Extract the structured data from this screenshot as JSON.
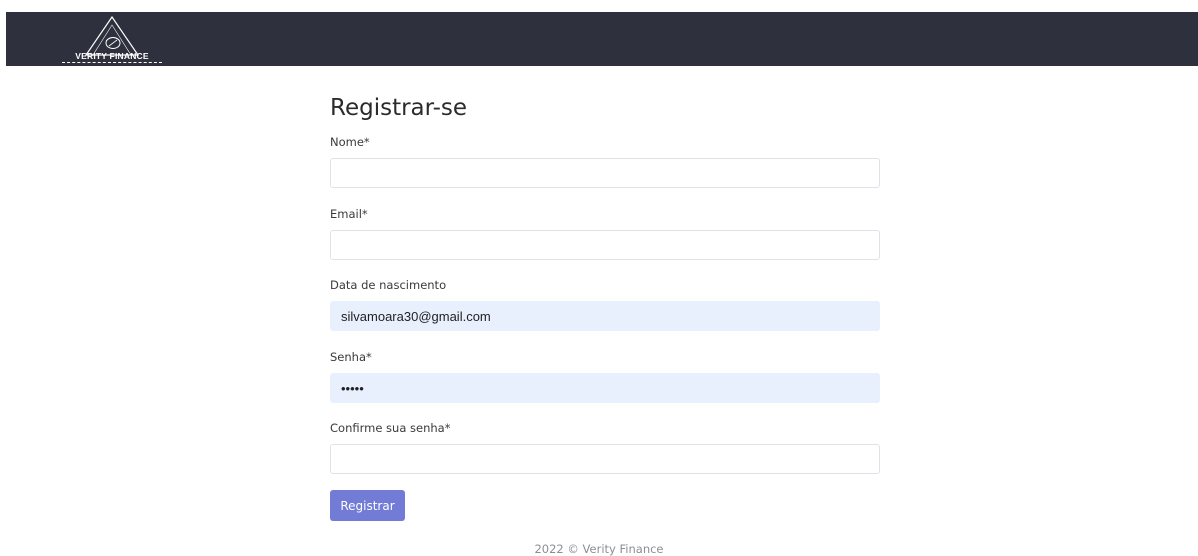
{
  "header": {
    "logo_text": "VERITY FINANCE"
  },
  "form": {
    "title": "Registrar-se",
    "fields": [
      {
        "label": "Nome*",
        "value": "",
        "type": "text"
      },
      {
        "label": "Email*",
        "value": "",
        "type": "text"
      },
      {
        "label": "Data de nascimento",
        "value": "silvamoara30@gmail.com",
        "type": "text"
      },
      {
        "label": "Senha*",
        "value": "•••••",
        "type": "password"
      },
      {
        "label": "Confirme sua senha*",
        "value": "",
        "type": "password"
      }
    ],
    "submit_label": "Registrar"
  },
  "footer": {
    "text": "2022 © Verity Finance"
  },
  "colors": {
    "topbar": "#2e303d",
    "button": "#727cd6",
    "autofill": "#e8f0fe"
  }
}
